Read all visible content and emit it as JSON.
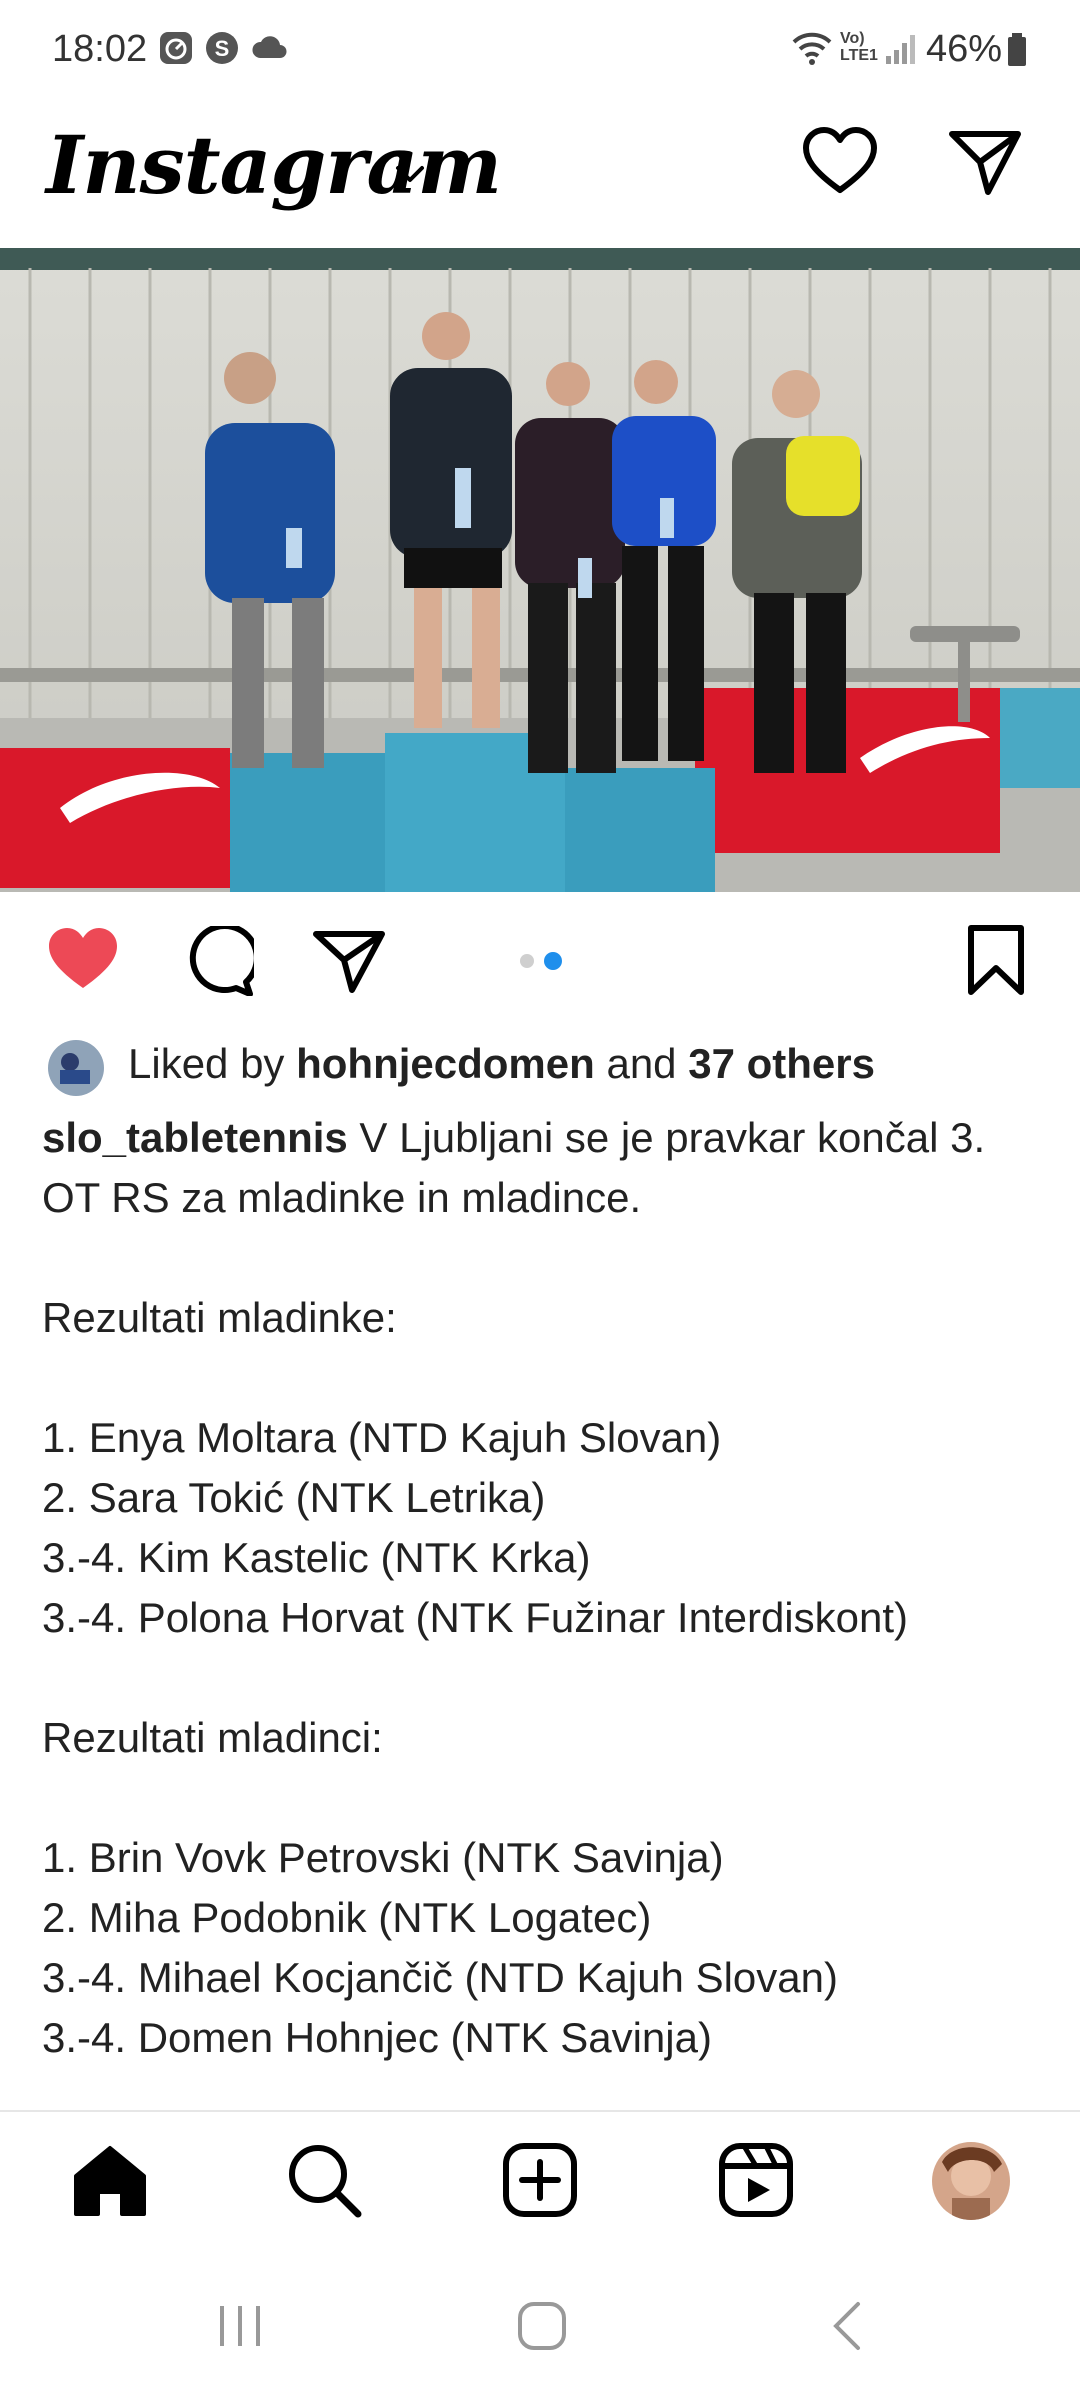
{
  "status_bar": {
    "time": "18:02",
    "battery": "46%",
    "network_label": "Vo) LTE1",
    "icons": [
      "speed-icon",
      "s-app-icon",
      "cloud-icon",
      "wifi-icon",
      "signal-icon",
      "battery-icon"
    ]
  },
  "header": {
    "logo": "Instagram",
    "icons": [
      "chevron-down-icon",
      "heart-icon",
      "send-icon"
    ]
  },
  "post": {
    "image_alt": "",
    "carousel": {
      "count": 2,
      "active": 2
    },
    "actions": [
      "like-icon",
      "comment-icon",
      "share-icon",
      "bookmark-icon"
    ],
    "like_color": "#ed4956",
    "likes": {
      "prefix": "Liked by ",
      "user": "hohnjecdomen",
      "middle": " and ",
      "others": "37 others"
    },
    "caption": {
      "username": "slo_tabletennis",
      "text": " V Ljubljani se je pravkar končal 3. OT RS za mladinke in mladince.\n\nRezultati mladinke:\n\n1. Enya Moltara (NTD Kajuh Slovan)\n2. Sara Tokić (NTK Letrika)\n3.-4. Kim Kastelic (NTK Krka)\n3.-4. Polona Horvat (NTK Fužinar Interdiskont)\n\nRezultati mladinci:\n\n1. Brin Vovk Petrovski (NTK Savinja)\n2. Miha Podobnik (NTK Logatec)\n3.-4. Mihael Kocjančič (NTD Kajuh Slovan)\n3.-4. Domen Hohnjec (NTK Savinja)"
    }
  },
  "bottom_nav": {
    "items": [
      "home-icon",
      "search-icon",
      "create-icon",
      "reels-icon",
      "profile-avatar"
    ]
  },
  "system_nav": {
    "items": [
      "recents-icon",
      "home-circle-icon",
      "back-icon"
    ]
  },
  "colors": {
    "accent_blue": "#1f8fec",
    "brand_red": "#ed4956"
  }
}
